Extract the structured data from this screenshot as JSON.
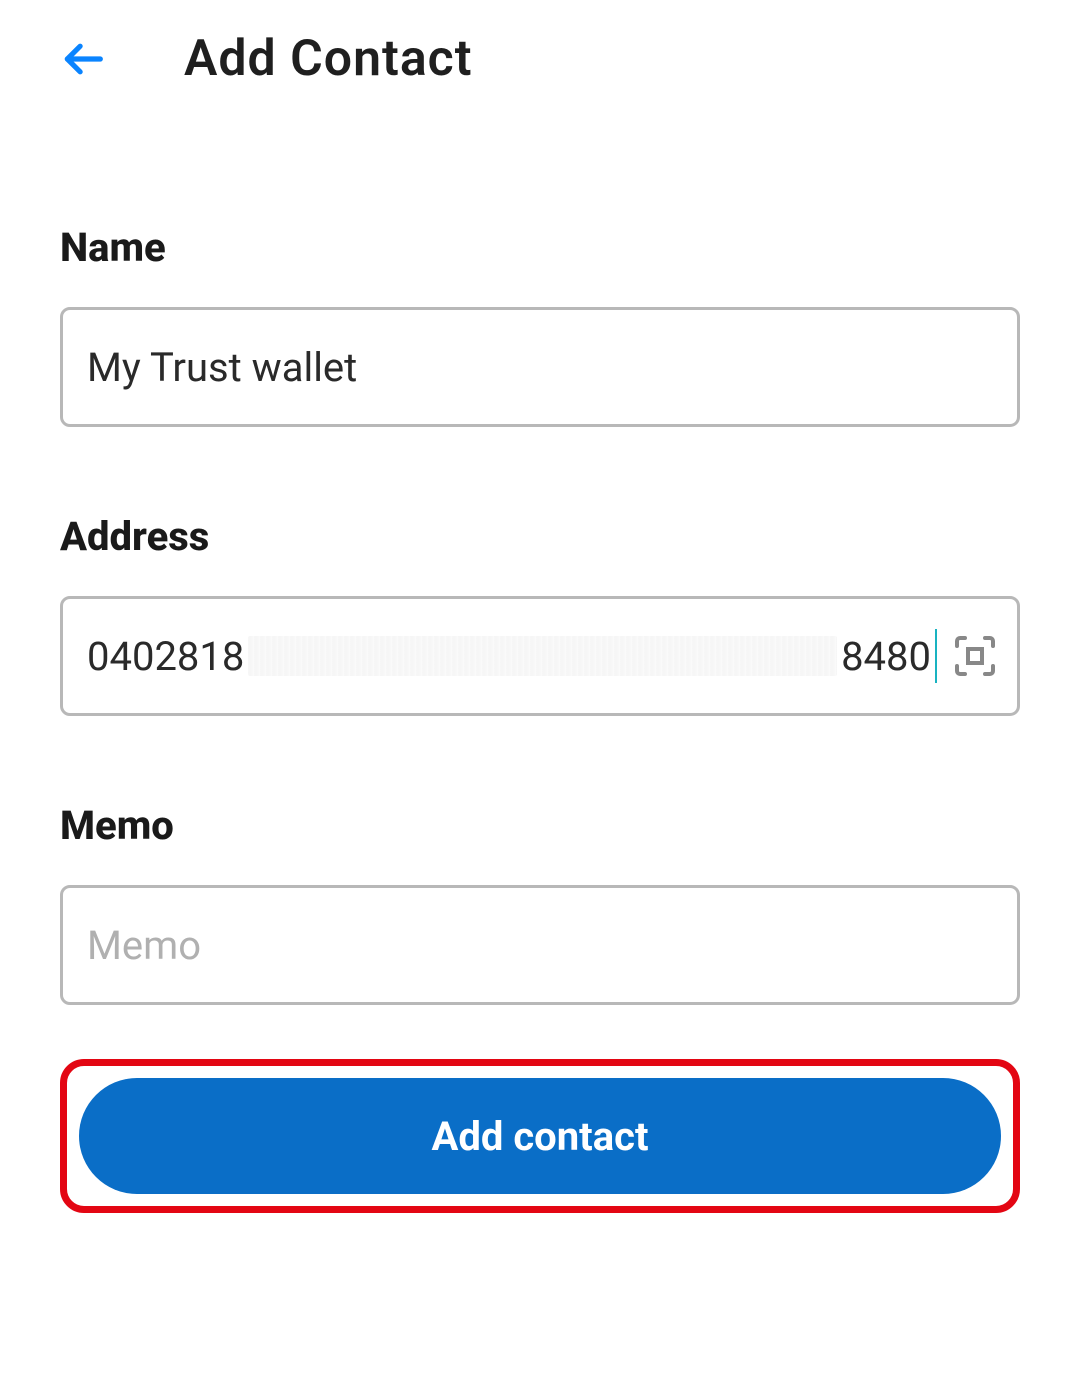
{
  "header": {
    "title": "Add Contact"
  },
  "form": {
    "name": {
      "label": "Name",
      "value": "My Trust wallet"
    },
    "address": {
      "label": "Address",
      "start": "0402818",
      "end": "8480"
    },
    "memo": {
      "label": "Memo",
      "placeholder": "Memo",
      "value": ""
    }
  },
  "actions": {
    "submit_label": "Add contact"
  }
}
